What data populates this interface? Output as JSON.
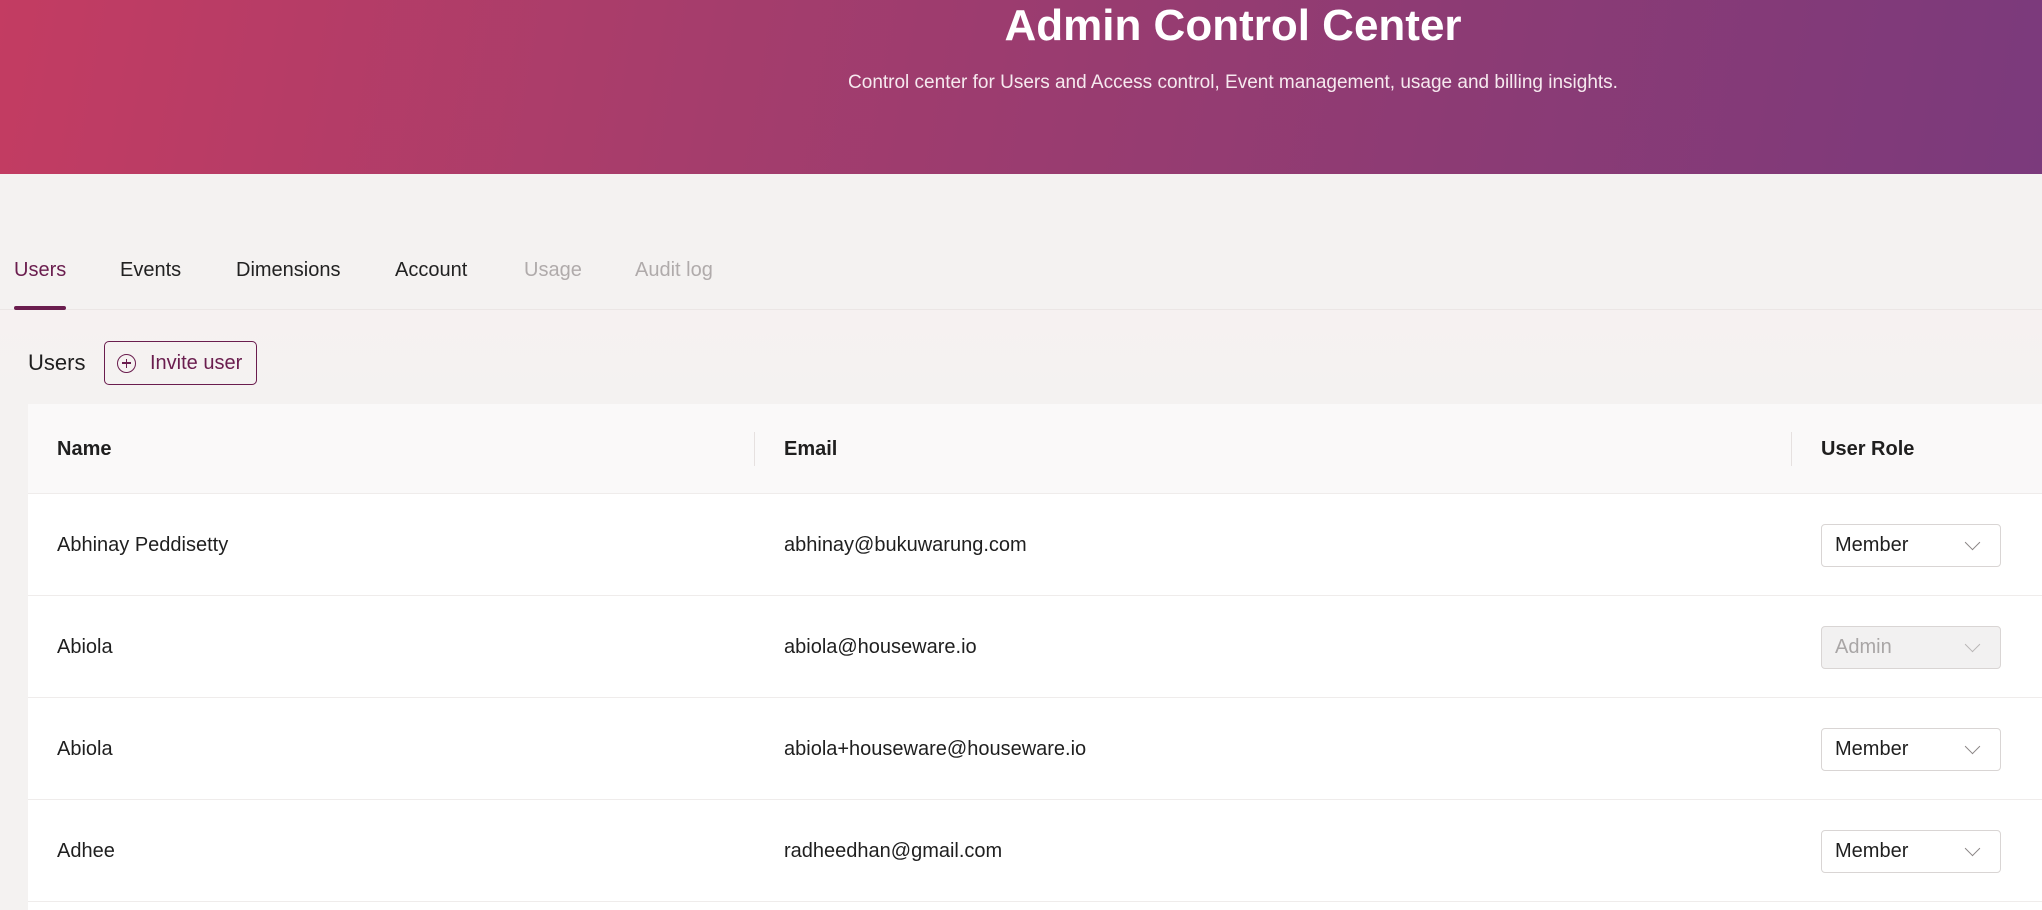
{
  "header": {
    "title": "Admin Control Center",
    "subtitle": "Control center for Users and Access control, Event management, usage and billing insights."
  },
  "tabs": [
    {
      "label": "Users",
      "state": "active"
    },
    {
      "label": "Events",
      "state": "normal"
    },
    {
      "label": "Dimensions",
      "state": "normal"
    },
    {
      "label": "Account",
      "state": "normal"
    },
    {
      "label": "Usage",
      "state": "disabled"
    },
    {
      "label": "Audit log",
      "state": "disabled"
    }
  ],
  "users_section": {
    "title": "Users",
    "invite_button": "Invite user"
  },
  "table": {
    "columns": [
      "Name",
      "Email",
      "User Role"
    ],
    "rows": [
      {
        "name": "Abhinay Peddisetty",
        "email": "abhinay@bukuwarung.com",
        "role": "Member",
        "role_disabled": false
      },
      {
        "name": "Abiola",
        "email": "abiola@houseware.io",
        "role": "Admin",
        "role_disabled": true
      },
      {
        "name": "Abiola",
        "email": "abiola+houseware@houseware.io",
        "role": "Member",
        "role_disabled": false
      },
      {
        "name": "Adhee",
        "email": "radheedhan@gmail.com",
        "role": "Member",
        "role_disabled": false
      }
    ]
  },
  "colors": {
    "accent": "#6a1d4e",
    "hero_gradient_start": "#c33c62",
    "hero_gradient_end": "#7b3a7c"
  }
}
